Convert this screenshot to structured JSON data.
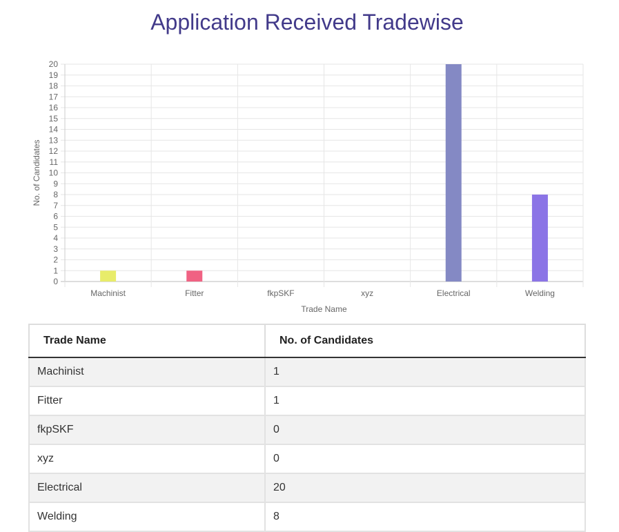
{
  "page": {
    "title": "Application Received Tradewise"
  },
  "chart_data": {
    "type": "bar",
    "categories": [
      "Machinist",
      "Fitter",
      "fkpSKF",
      "xyz",
      "Electrical",
      "Welding"
    ],
    "values": [
      1,
      1,
      0,
      0,
      20,
      8
    ],
    "colors": [
      "#e8ec6a",
      "#f06283",
      "#cccccc",
      "#cccccc",
      "#8489c4",
      "#8b74e6"
    ],
    "xlabel": "Trade Name",
    "ylabel": "No. of Candidates",
    "ylim": [
      0,
      20
    ],
    "yticks": [
      0,
      1,
      2,
      3,
      4,
      5,
      6,
      7,
      8,
      9,
      10,
      11,
      12,
      13,
      14,
      15,
      16,
      17,
      18,
      19,
      20
    ],
    "grid": true
  },
  "table": {
    "headers": [
      "Trade Name",
      "No. of Candidates"
    ],
    "rows": [
      [
        "Machinist",
        "1"
      ],
      [
        "Fitter",
        "1"
      ],
      [
        "fkpSKF",
        "0"
      ],
      [
        "xyz",
        "0"
      ],
      [
        "Electrical",
        "20"
      ],
      [
        "Welding",
        "8"
      ]
    ]
  }
}
